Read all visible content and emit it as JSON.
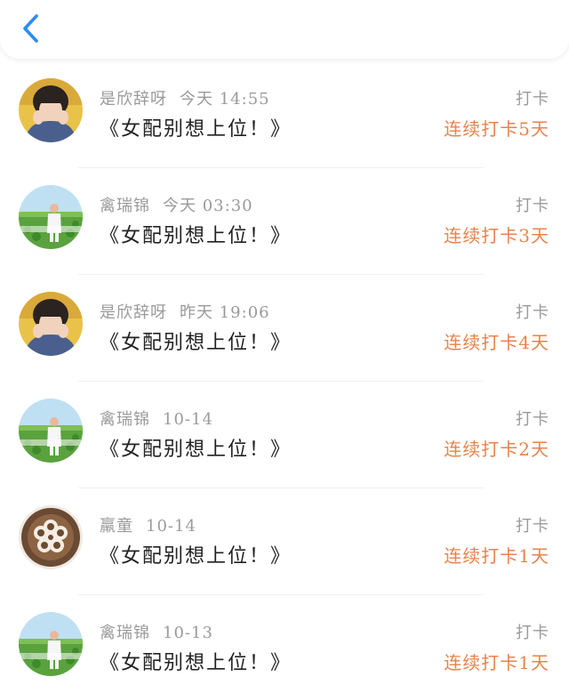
{
  "header": {
    "back_icon": "chevron-left-icon",
    "accent_color": "#2d8cf0"
  },
  "colors": {
    "streak": "#e8834a",
    "meta": "#9a9a9a",
    "title": "#222222"
  },
  "items": [
    {
      "user": "是欣辞呀",
      "time": "今天 14:55",
      "book": "《女配别想上位！》",
      "action": "打卡",
      "streak": "连续打卡5天",
      "avatar": "person-portrait"
    },
    {
      "user": "禽瑞锦",
      "time": "今天 03:30",
      "book": "《女配别想上位！》",
      "action": "打卡",
      "streak": "连续打卡3天",
      "avatar": "field-figure"
    },
    {
      "user": "是欣辞呀",
      "time": "昨天 19:06",
      "book": "《女配别想上位！》",
      "action": "打卡",
      "streak": "连续打卡4天",
      "avatar": "person-portrait"
    },
    {
      "user": "禽瑞锦",
      "time": "10-14",
      "book": "《女配别想上位！》",
      "action": "打卡",
      "streak": "连续打卡2天",
      "avatar": "field-figure"
    },
    {
      "user": "羸童",
      "time": "10-14",
      "book": "《女配别想上位！》",
      "action": "打卡",
      "streak": "连续打卡1天",
      "avatar": "latte-art"
    },
    {
      "user": "禽瑞锦",
      "time": "10-13",
      "book": "《女配别想上位！》",
      "action": "打卡",
      "streak": "连续打卡1天",
      "avatar": "field-figure"
    }
  ]
}
